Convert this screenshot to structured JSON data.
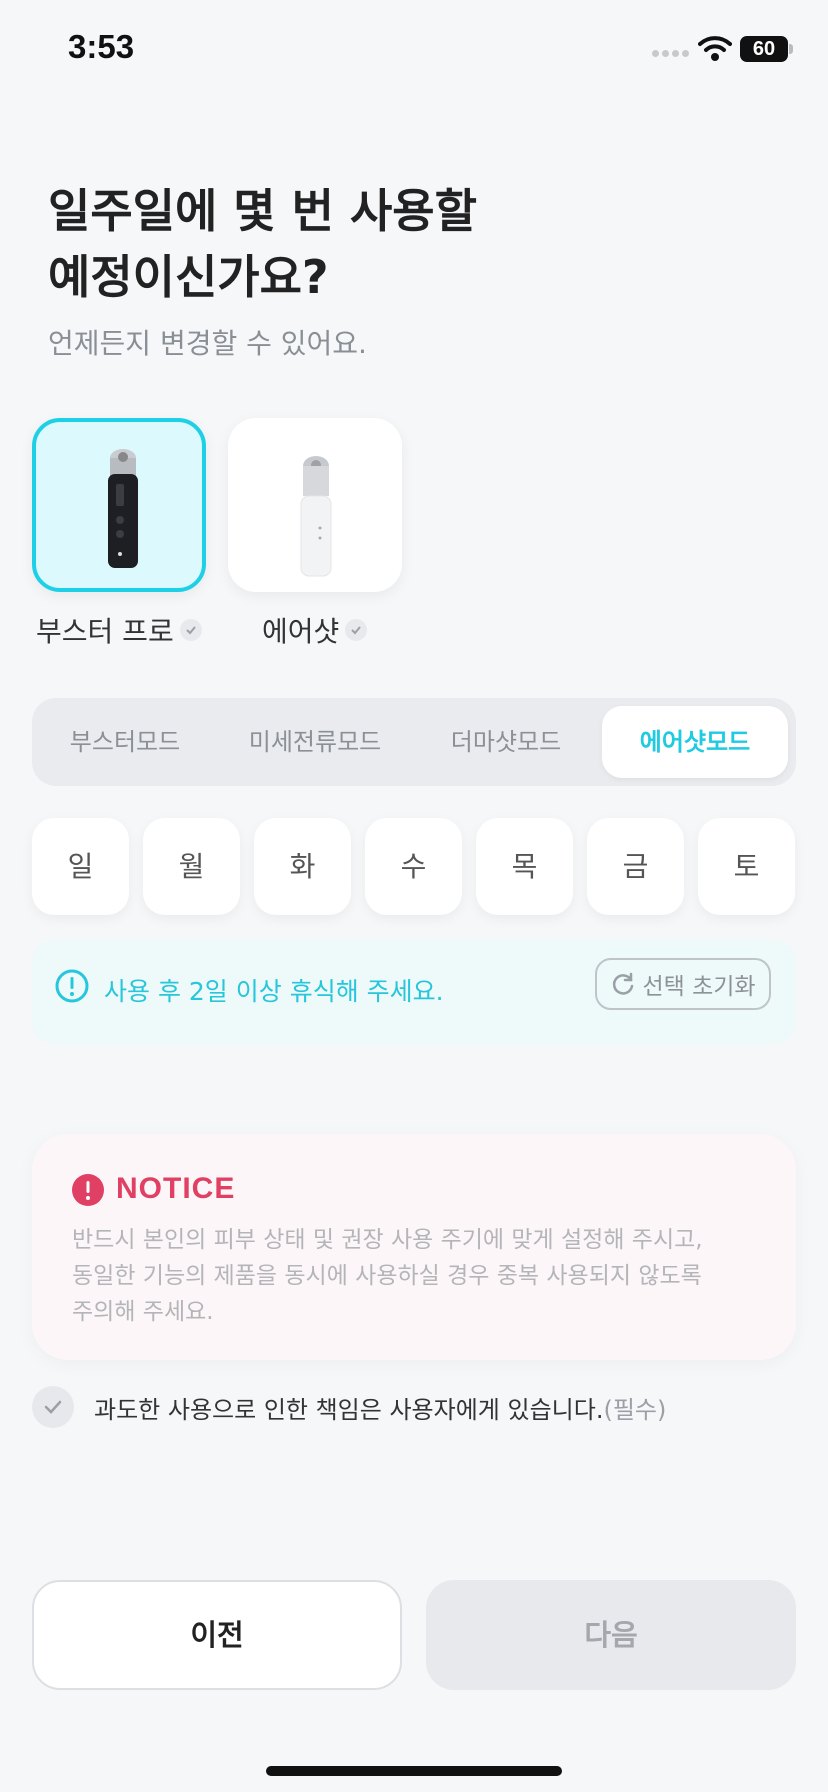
{
  "status_bar": {
    "time": "3:53",
    "battery": "60"
  },
  "header": {
    "title": "일주일에 몇 번 사용할\n예정이신가요?",
    "subtitle": "언제든지 변경할 수 있어요."
  },
  "devices": [
    {
      "label": "부스터 프로",
      "selected": true
    },
    {
      "label": "에어샷",
      "selected": false
    }
  ],
  "modes": [
    {
      "label": "부스터모드",
      "active": false
    },
    {
      "label": "미세전류모드",
      "active": false
    },
    {
      "label": "더마샷모드",
      "active": false
    },
    {
      "label": "에어샷모드",
      "active": true
    }
  ],
  "days": [
    "일",
    "월",
    "화",
    "수",
    "목",
    "금",
    "토"
  ],
  "rest_info": {
    "message": "사용 후 2일 이상 휴식해 주세요.",
    "reset_label": "선택 초기화"
  },
  "notice": {
    "title": "NOTICE",
    "body": "반드시 본인의 피부 상태 및 권장 사용 주기에 맞게 설정해 주시고,\n동일한 기능의 제품을 동시에 사용하실 경우 중복 사용되지 않도록\n주의해 주세요."
  },
  "agreement": {
    "text": "과도한 사용으로 인한 책임은 사용자에게 있습니다.",
    "required": "(필수)"
  },
  "buttons": {
    "prev": "이전",
    "next": "다음"
  },
  "colors": {
    "accent": "#1ecbe1",
    "notice": "#df4063"
  }
}
